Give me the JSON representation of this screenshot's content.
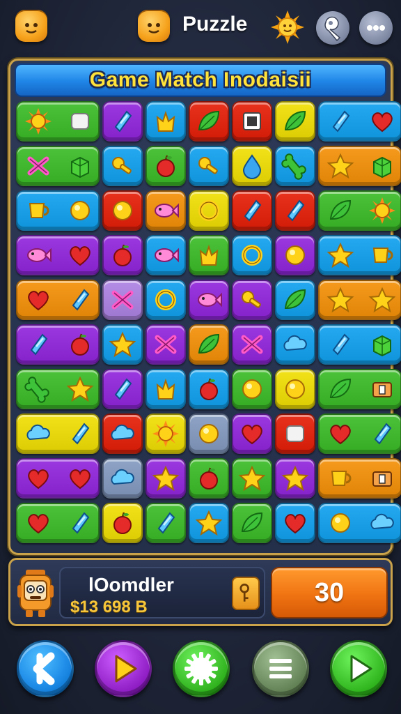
{
  "header": {
    "title": "Puzzle",
    "left_icon": "star-face-icon",
    "icons": [
      "star-face-icon",
      "sun-icon",
      "wrench-icon",
      "more-icon"
    ]
  },
  "board": {
    "banner": "Game Match Inodaisii",
    "rows": [
      [
        {
          "kind": "wide",
          "color": "#4cc23a",
          "icons": [
            "sun",
            "square"
          ]
        },
        {
          "color": "#9b38e0",
          "icons": [
            "gem"
          ]
        },
        {
          "color": "#25a9f0",
          "icons": [
            "crown"
          ]
        },
        {
          "color": "#e8321e",
          "icons": [
            "leaf"
          ]
        },
        {
          "color": "#e8321e",
          "icons": [
            "square-dark"
          ]
        },
        {
          "color": "#f2e21a",
          "icons": [
            "leaf"
          ]
        },
        {
          "kind": "wide",
          "color": "#25a9f0",
          "icons": [
            "gem",
            "heart"
          ]
        }
      ],
      [
        {
          "kind": "wide",
          "color": "#4cc23a",
          "icons": [
            "x",
            "cube"
          ]
        },
        {
          "color": "#25a9f0",
          "icons": [
            "key"
          ]
        },
        {
          "color": "#4cc23a",
          "icons": [
            "apple"
          ]
        },
        {
          "color": "#25a9f0",
          "icons": [
            "key"
          ]
        },
        {
          "color": "#f2e21a",
          "icons": [
            "drop"
          ]
        },
        {
          "color": "#25a9f0",
          "icons": [
            "bone"
          ]
        },
        {
          "kind": "wide",
          "color": "#f59a1c",
          "icons": [
            "star",
            "cube"
          ]
        }
      ],
      [
        {
          "kind": "wide",
          "color": "#25a9f0",
          "icons": [
            "cup",
            "circle"
          ]
        },
        {
          "color": "#e8321e",
          "icons": [
            "circle"
          ]
        },
        {
          "color": "#f59a1c",
          "icons": [
            "fish"
          ]
        },
        {
          "color": "#f2e21a",
          "icons": [
            "ring"
          ]
        },
        {
          "color": "#e8321e",
          "icons": [
            "gem"
          ]
        },
        {
          "color": "#e8321e",
          "icons": [
            "gem"
          ]
        },
        {
          "kind": "wide",
          "color": "#4cc23a",
          "icons": [
            "leaf",
            "sun"
          ]
        }
      ],
      [
        {
          "kind": "wide",
          "color": "#9b38e0",
          "icons": [
            "fish",
            "heart"
          ]
        },
        {
          "color": "#9b38e0",
          "icons": [
            "apple"
          ]
        },
        {
          "color": "#25a9f0",
          "icons": [
            "fish"
          ]
        },
        {
          "color": "#4cc23a",
          "icons": [
            "crown"
          ]
        },
        {
          "color": "#25a9f0",
          "icons": [
            "ring"
          ]
        },
        {
          "color": "#9b38e0",
          "icons": [
            "circle"
          ]
        },
        {
          "kind": "wide",
          "color": "#25a9f0",
          "icons": [
            "star",
            "cup"
          ]
        }
      ],
      [
        {
          "kind": "wide",
          "color": "#f59a1c",
          "icons": [
            "heart",
            "gem"
          ]
        },
        {
          "color": "#b48ee6",
          "icons": [
            "x"
          ]
        },
        {
          "color": "#25a9f0",
          "icons": [
            "ring"
          ]
        },
        {
          "color": "#9b38e0",
          "icons": [
            "fish"
          ]
        },
        {
          "color": "#9b38e0",
          "icons": [
            "key"
          ]
        },
        {
          "color": "#25a9f0",
          "icons": [
            "leaf"
          ]
        },
        {
          "kind": "wide",
          "color": "#f59a1c",
          "icons": [
            "star",
            "star"
          ]
        }
      ],
      [
        {
          "kind": "wide",
          "color": "#9b38e0",
          "icons": [
            "gem",
            "apple"
          ]
        },
        {
          "color": "#25a9f0",
          "icons": [
            "star"
          ]
        },
        {
          "color": "#9b38e0",
          "icons": [
            "x"
          ]
        },
        {
          "color": "#f59a1c",
          "icons": [
            "leaf"
          ]
        },
        {
          "color": "#9b38e0",
          "icons": [
            "x"
          ]
        },
        {
          "color": "#25a9f0",
          "icons": [
            "cloud"
          ]
        },
        {
          "kind": "wide",
          "color": "#25a9f0",
          "icons": [
            "gem",
            "cube"
          ]
        }
      ],
      [
        {
          "kind": "wide",
          "color": "#4cc23a",
          "icons": [
            "bone",
            "star"
          ]
        },
        {
          "color": "#9b38e0",
          "icons": [
            "gem"
          ]
        },
        {
          "color": "#25a9f0",
          "icons": [
            "crown"
          ]
        },
        {
          "color": "#25a9f0",
          "icons": [
            "apple"
          ]
        },
        {
          "color": "#4cc23a",
          "icons": [
            "circle"
          ]
        },
        {
          "color": "#f2e21a",
          "icons": [
            "circle"
          ]
        },
        {
          "kind": "wide",
          "color": "#4cc23a",
          "icons": [
            "leaf",
            "box"
          ]
        }
      ],
      [
        {
          "kind": "wide",
          "color": "#f2e21a",
          "icons": [
            "cloud",
            "gem"
          ]
        },
        {
          "color": "#e8321e",
          "icons": [
            "cloud"
          ]
        },
        {
          "color": "#f2e21a",
          "icons": [
            "sun"
          ]
        },
        {
          "color": "#8ea3c6",
          "icons": [
            "circle"
          ]
        },
        {
          "color": "#9b38e0",
          "icons": [
            "heart"
          ]
        },
        {
          "color": "#e8321e",
          "icons": [
            "square"
          ]
        },
        {
          "kind": "wide",
          "color": "#4cc23a",
          "icons": [
            "heart",
            "gem"
          ]
        }
      ],
      [
        {
          "kind": "wide",
          "color": "#9b38e0",
          "icons": [
            "heart",
            "heart"
          ]
        },
        {
          "color": "#8ea3c6",
          "icons": [
            "cloud"
          ]
        },
        {
          "color": "#9b38e0",
          "icons": [
            "star"
          ]
        },
        {
          "color": "#4cc23a",
          "icons": [
            "apple"
          ]
        },
        {
          "color": "#4cc23a",
          "icons": [
            "star"
          ]
        },
        {
          "color": "#9b38e0",
          "icons": [
            "star"
          ]
        },
        {
          "kind": "wide",
          "color": "#f59a1c",
          "icons": [
            "cup",
            "box"
          ]
        }
      ],
      [
        {
          "kind": "wide",
          "color": "#4cc23a",
          "icons": [
            "heart",
            "gem"
          ]
        },
        {
          "color": "#f2e21a",
          "icons": [
            "apple"
          ]
        },
        {
          "color": "#4cc23a",
          "icons": [
            "gem"
          ]
        },
        {
          "color": "#25a9f0",
          "icons": [
            "star"
          ]
        },
        {
          "color": "#4cc23a",
          "icons": [
            "leaf"
          ]
        },
        {
          "color": "#25a9f0",
          "icons": [
            "heart"
          ]
        },
        {
          "kind": "wide",
          "color": "#25a9f0",
          "icons": [
            "circle",
            "cloud"
          ]
        }
      ]
    ]
  },
  "player": {
    "name": "lOomdler",
    "coins": "$13 698 B",
    "avatar_icon": "robot-icon",
    "key_icon": "key-icon",
    "score": "30"
  },
  "controls": [
    {
      "name": "back-button",
      "icon": "back-icon",
      "color": "#1f8de8"
    },
    {
      "name": "play-button",
      "icon": "play-icon",
      "color": "#9b2bd0"
    },
    {
      "name": "settings-button",
      "icon": "gear-icon",
      "color": "#3cbf2a"
    },
    {
      "name": "menu-button",
      "icon": "menu-icon",
      "color": "#6f8f62"
    },
    {
      "name": "next-button",
      "icon": "play-icon",
      "color": "#3cc12a"
    }
  ]
}
